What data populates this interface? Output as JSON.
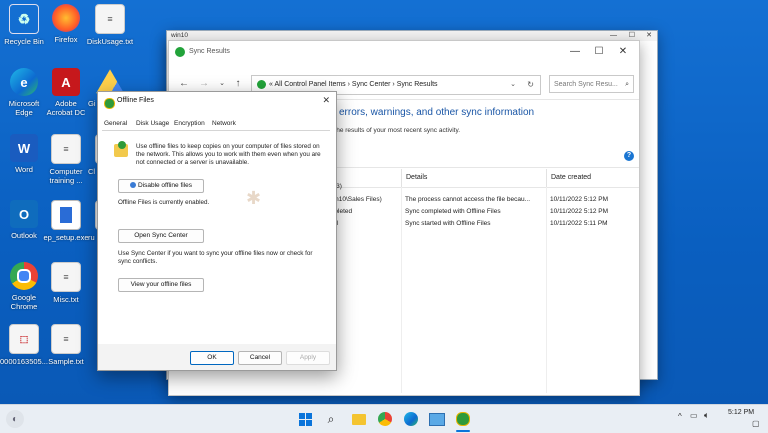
{
  "desktop": {
    "icons": [
      {
        "label": "Recycle Bin"
      },
      {
        "label": "Firefox"
      },
      {
        "label": "DiskUsage.txt"
      },
      {
        "label": "Microsoft Edge"
      },
      {
        "label": "Adobe Acrobat DC"
      },
      {
        "label": "Gi"
      },
      {
        "label": "Word"
      },
      {
        "label": "Computer training ..."
      },
      {
        "label": "Cl"
      },
      {
        "label": "Outlook"
      },
      {
        "label": "ep_setup.exe"
      },
      {
        "label": "ru"
      },
      {
        "label": "Google Chrome"
      },
      {
        "label": "Misc.txt"
      },
      {
        "label": "0000163505..."
      },
      {
        "label": "Sample.txt"
      }
    ]
  },
  "outer_window": {
    "title": "win10"
  },
  "sync_window": {
    "title": "Sync Results",
    "address": {
      "prefix": "«",
      "parts": [
        "All Control Panel Items",
        "Sync Center",
        "Sync Results"
      ],
      "sep": "›"
    },
    "search_placeholder": "Search Sync Resu...",
    "heading": "w errors, warnings, and other sync information",
    "subtext": "e the results of your most recent sync activity.",
    "columns": [
      "Details",
      "Date created"
    ],
    "group_label": "(3)",
    "rows": [
      {
        "name": "win10\\Sales Files)",
        "details": "The process cannot access the file becau...",
        "date": "10/11/2022 5:12 PM"
      },
      {
        "name": "mpleted",
        "details": "Sync completed with Offline Files",
        "date": "10/11/2022 5:12 PM"
      },
      {
        "name": "ted",
        "details": "Sync started with Offline Files",
        "date": "10/11/2022 5:11 PM"
      }
    ]
  },
  "dialog": {
    "title": "Offline Files",
    "tabs": [
      "General",
      "Disk Usage",
      "Encryption",
      "Network"
    ],
    "description": "Use offline files to keep copies on your computer of files stored on the network. This allows you to work with them even when you are not connected or a server is unavailable.",
    "disable_button": "Disable offline files",
    "status": "Offline Files is currently enabled.",
    "open_sync_button": "Open Sync Center",
    "sync_hint": "Use Sync Center if you want to sync your offline files now or check for sync conflicts.",
    "view_button": "View your offline files",
    "ok": "OK",
    "cancel": "Cancel",
    "apply": "Apply"
  },
  "taskbar": {
    "time": "5:12 PM",
    "icons": [
      "start-icon",
      "search-icon",
      "file-explorer-icon",
      "chrome-icon",
      "edge-icon",
      "control-panel-icon",
      "sync-center-icon"
    ]
  },
  "colors": {
    "desktop": "#0c64c2",
    "accent": "#0067c0",
    "heading": "#1a56a6"
  }
}
